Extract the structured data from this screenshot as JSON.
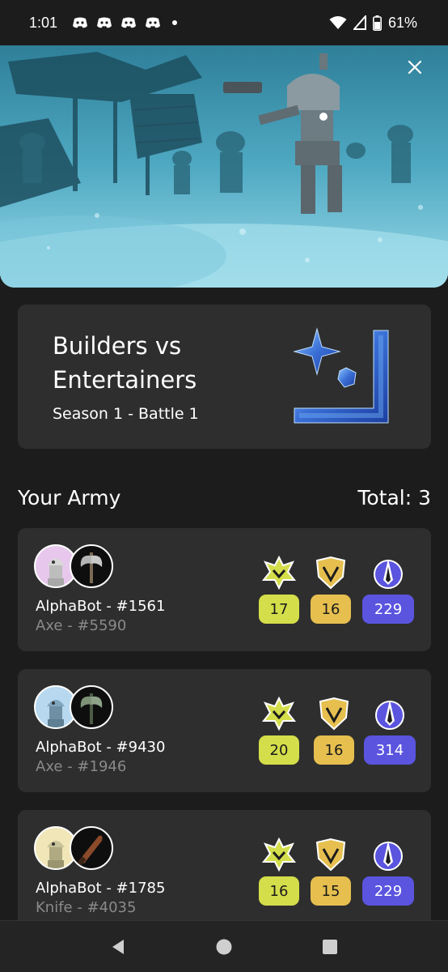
{
  "status_bar": {
    "time": "1:01",
    "battery": "61%",
    "icons": [
      "discord-icon",
      "discord-icon",
      "discord-icon",
      "discord-icon",
      "dot-icon",
      "wifi-icon",
      "signal-icon",
      "battery-icon"
    ]
  },
  "hero": {
    "close_icon": "close-icon"
  },
  "battle": {
    "title": "Builders vs Entertainers",
    "subtitle": "Season 1 - Battle 1"
  },
  "army": {
    "heading": "Your Army",
    "total": "Total: 3",
    "units": [
      {
        "bot": "AlphaBot - #1561",
        "weapon": "Axe - #5590",
        "stats": [
          "17",
          "16",
          "229"
        ]
      },
      {
        "bot": "AlphaBot - #9430",
        "weapon": "Axe - #1946",
        "stats": [
          "20",
          "16",
          "314"
        ]
      },
      {
        "bot": "AlphaBot - #1785",
        "weapon": "Knife - #4035",
        "stats": [
          "16",
          "15",
          "229"
        ]
      }
    ]
  },
  "colors": {
    "background": "#1c1c1c",
    "card": "#2e2e2e",
    "badge_yellow": "#d4de4a",
    "badge_gold": "#e6bf4f",
    "badge_blue": "#5a54df",
    "muted_text": "#8a8a8a"
  },
  "nav": {
    "icons": [
      "back-icon",
      "home-icon",
      "recents-icon"
    ]
  }
}
